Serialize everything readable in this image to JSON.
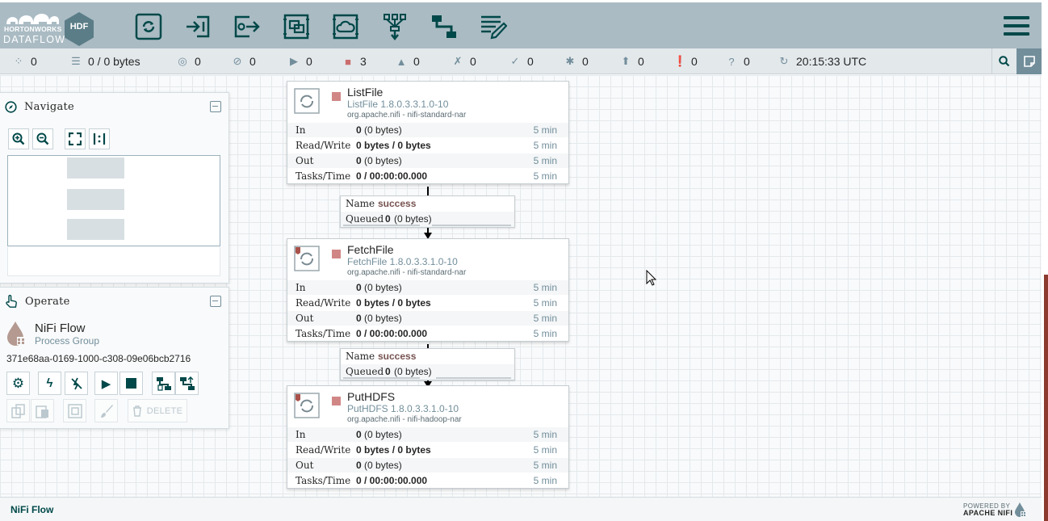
{
  "brand": {
    "company": "HORTONWORKS",
    "product": "DATAFLOW",
    "badge": "HDF"
  },
  "toolbar": {
    "items": [
      {
        "name": "processor"
      },
      {
        "name": "input-port"
      },
      {
        "name": "output-port"
      },
      {
        "name": "process-group"
      },
      {
        "name": "remote-process-group"
      },
      {
        "name": "funnel"
      },
      {
        "name": "template"
      },
      {
        "name": "label"
      }
    ]
  },
  "status": {
    "transmitting_count": "0",
    "queued": "0 / 0 bytes",
    "transmitting_remote": "0",
    "not_transmitting_remote": "0",
    "running": "0",
    "stopped": "3",
    "invalid": "0",
    "disabled": "0",
    "up_to_date": "0",
    "locally_modified": "0",
    "stale": "0",
    "locally_modified_stale": "0",
    "sync_failure": "0",
    "refresh_time": "20:15:33 UTC"
  },
  "navigate": {
    "title": "Navigate"
  },
  "operate": {
    "title": "Operate",
    "component_name": "NiFi Flow",
    "component_type": "Process Group",
    "component_id": "371e68aa-0169-1000-c308-09e06bcb2716",
    "delete_label": "DELETE"
  },
  "processors": [
    {
      "name": "ListFile",
      "type": "ListFile 1.8.0.3.3.1.0-10",
      "bundle": "org.apache.nifi - nifi-standard-nar",
      "stats": [
        {
          "label": "In",
          "value": "0",
          "detail": "(0 bytes)",
          "period": "5 min"
        },
        {
          "label": "Read/Write",
          "value": "0 bytes / 0 bytes",
          "detail": "",
          "period": "5 min"
        },
        {
          "label": "Out",
          "value": "0",
          "detail": "(0 bytes)",
          "period": "5 min"
        },
        {
          "label": "Tasks/Time",
          "value": "0 / 00:00:00.000",
          "detail": "",
          "period": "5 min"
        }
      ]
    },
    {
      "name": "FetchFile",
      "type": "FetchFile 1.8.0.3.3.1.0-10",
      "bundle": "org.apache.nifi - nifi-standard-nar",
      "stats": [
        {
          "label": "In",
          "value": "0",
          "detail": "(0 bytes)",
          "period": "5 min"
        },
        {
          "label": "Read/Write",
          "value": "0 bytes / 0 bytes",
          "detail": "",
          "period": "5 min"
        },
        {
          "label": "Out",
          "value": "0",
          "detail": "(0 bytes)",
          "period": "5 min"
        },
        {
          "label": "Tasks/Time",
          "value": "0 / 00:00:00.000",
          "detail": "",
          "period": "5 min"
        }
      ]
    },
    {
      "name": "PutHDFS",
      "type": "PutHDFS 1.8.0.3.3.1.0-10",
      "bundle": "org.apache.nifi - nifi-hadoop-nar",
      "stats": [
        {
          "label": "In",
          "value": "0",
          "detail": "(0 bytes)",
          "period": "5 min"
        },
        {
          "label": "Read/Write",
          "value": "0 bytes / 0 bytes",
          "detail": "",
          "period": "5 min"
        },
        {
          "label": "Out",
          "value": "0",
          "detail": "(0 bytes)",
          "period": "5 min"
        },
        {
          "label": "Tasks/Time",
          "value": "0 / 00:00:00.000",
          "detail": "",
          "period": "5 min"
        }
      ]
    }
  ],
  "connections": [
    {
      "name_label": "Name",
      "relationship": "success",
      "queued_label": "Queued",
      "queued_count": "0",
      "queued_size": "(0 bytes)"
    },
    {
      "name_label": "Name",
      "relationship": "success",
      "queued_label": "Queued",
      "queued_count": "0",
      "queued_size": "(0 bytes)"
    }
  ],
  "footer": {
    "breadcrumb": "NiFi Flow",
    "powered_by": "POWERED BY",
    "powered_name": "APACHE NIFI"
  },
  "colors": {
    "header_bg": "#aabbc3",
    "accent": "#004849",
    "stopped": "#d18686",
    "muted": "#728e9b"
  }
}
